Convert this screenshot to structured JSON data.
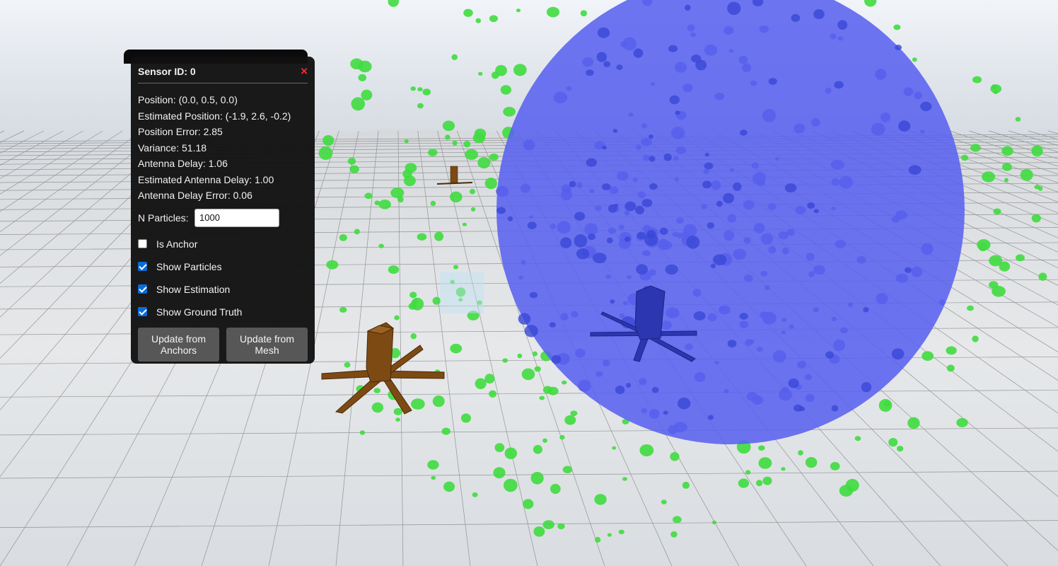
{
  "panel": {
    "title": "Sensor ID: 0",
    "close_icon": "close-icon",
    "info": [
      "Position: (0.0, 0.5, 0.0)",
      "Estimated Position: (-1.9, 2.6, -0.2)",
      "Position Error: 2.85",
      "Variance: 51.18",
      "Antenna Delay: 1.06",
      "Estimated Antenna Delay: 1.00",
      "Antenna Delay Error: 0.06"
    ],
    "particles_label": "N Particles:",
    "particles_value": "1000",
    "checkboxes": [
      {
        "label": "Is Anchor",
        "checked": false
      },
      {
        "label": "Show Particles",
        "checked": true
      },
      {
        "label": "Show Estimation",
        "checked": true
      },
      {
        "label": "Show Ground Truth",
        "checked": true
      }
    ],
    "buttons": {
      "update_anchors": "Update from Anchors",
      "update_mesh": "Update from Mesh"
    }
  },
  "scene": {
    "colors": {
      "sky": "#e9edf2",
      "floor": "#eceef0",
      "grid": "#6f6f6f",
      "sphere": "#5c64ef",
      "particles": "#3fdc3f",
      "sensor_truth": "#8a5418",
      "sensor_estimate": "#2f3bb8"
    }
  }
}
